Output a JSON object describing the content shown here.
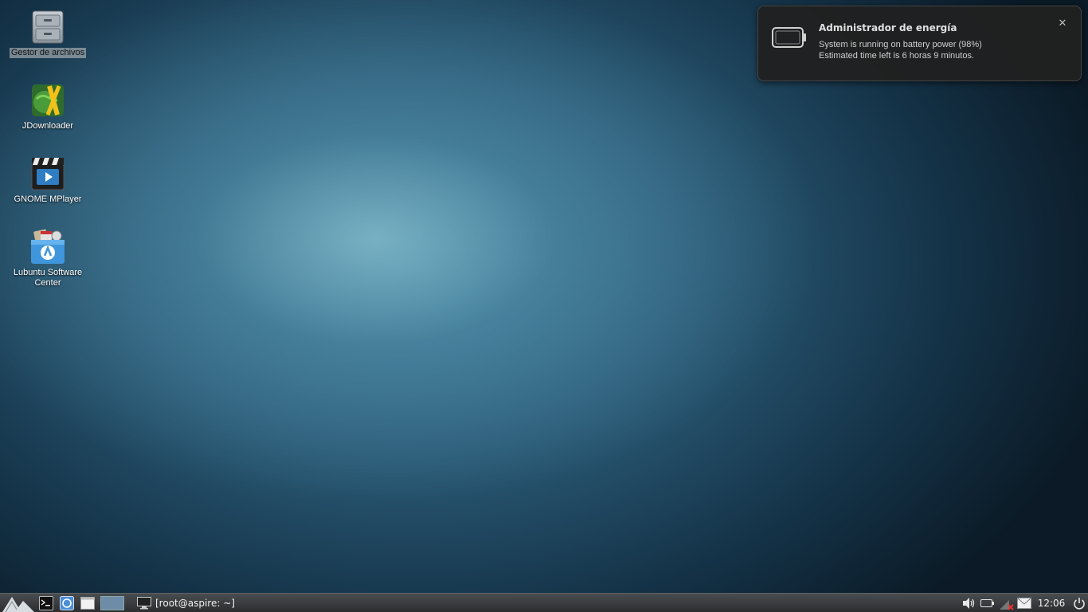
{
  "desktop": {
    "icons": [
      {
        "label": "Gestor de archivos",
        "icon": "file-cabinet-icon"
      },
      {
        "label": "JDownloader",
        "icon": "jdownloader-icon"
      },
      {
        "label": "GNOME MPlayer",
        "icon": "clapperboard-icon"
      },
      {
        "label": "Lubuntu Software Center",
        "icon": "software-center-icon"
      }
    ]
  },
  "notification": {
    "title": "Administrador de energía",
    "line1": "System is running on battery power (98%)",
    "line2": "Estimated time left is 6 horas 9 minutos.",
    "close_glyph": "✕",
    "icon": "battery-icon"
  },
  "taskbar": {
    "menu_icon": "lubuntu-menu-icon",
    "launchers": [
      "terminal-icon",
      "browser-icon",
      "show-desktop-icon"
    ],
    "task_label": "[root@aspire: ~]",
    "task_icon": "monitor-icon",
    "tray": [
      "volume-icon",
      "battery-icon",
      "network-disconnected-icon",
      "mail-icon"
    ],
    "clock": "12:06",
    "power_icon": "power-icon"
  },
  "colors": {
    "notification_bg": "#202020",
    "taskbar_bg": "#3a3c3e",
    "pager_active": "#6d8ca8"
  }
}
